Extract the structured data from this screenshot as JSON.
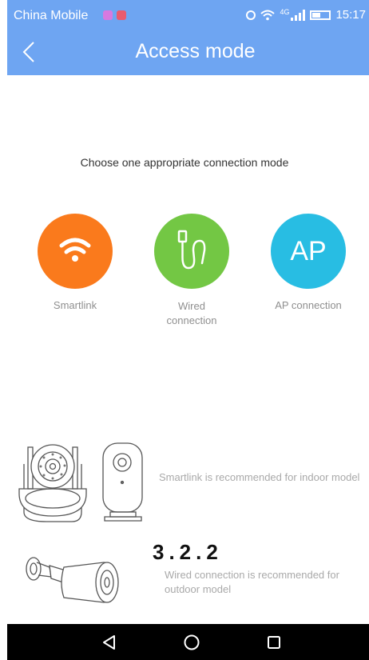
{
  "status_bar": {
    "carrier": "China Mobile",
    "network": "4G",
    "time": "15:17"
  },
  "header": {
    "title": "Access mode"
  },
  "content": {
    "subtitle": "Choose one appropriate connection mode",
    "modes": [
      {
        "label": "Smartlink",
        "color": "#fa7a1c",
        "icon": "wifi-icon"
      },
      {
        "label": "Wired connection",
        "color": "#73c744",
        "icon": "ethernet-cable-icon"
      },
      {
        "label": "AP connection",
        "color": "#28bde3",
        "icon_text": "AP"
      }
    ],
    "smartlink_hint": "Smartlink is recommended for indoor model",
    "version": "3.2.2",
    "wired_hint": "Wired connection is recommended for outdoor model"
  },
  "colors": {
    "header_bg": "#6ea5f2",
    "navbar_bg": "#000000"
  }
}
